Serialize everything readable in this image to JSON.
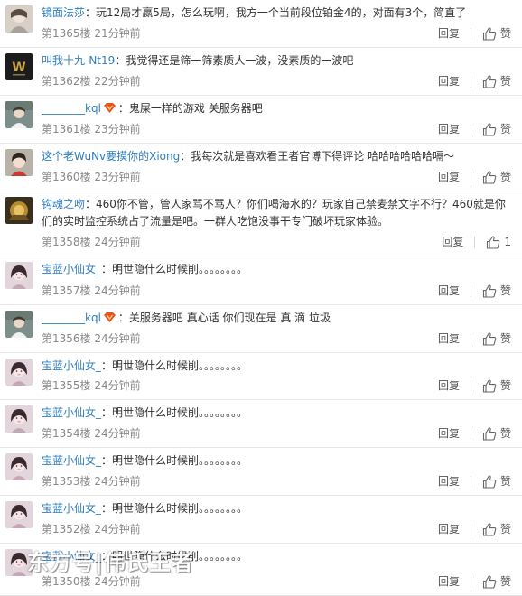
{
  "comments": [
    {
      "username": "镜面法莎",
      "text": "玩12局才赢5局，怎么玩啊，我方一个当前段位铂金4的，对面有3个，简直了",
      "floor": "第1365楼",
      "time": "21分钟前",
      "reply": "回复",
      "like": "赞",
      "avatar": "avatar-mirror"
    },
    {
      "username": "叫我十九-Nt19",
      "text": "我觉得还是筛一筛素质人一波，没素质的一波吧",
      "floor": "第1362楼",
      "time": "22分钟前",
      "reply": "回复",
      "like": "赞",
      "avatar": "avatar-w-logo"
    },
    {
      "username": "________kql",
      "text": "鬼屎一样的游戏 关服务器吧",
      "floor": "第1361楼",
      "time": "23分钟前",
      "reply": "回复",
      "like": "赞",
      "avatar": "avatar-character"
    },
    {
      "username": "这个老WuNv要摸你的Xiong",
      "text": "我每次就是喜欢看王者官博下得评论 哈哈哈哈哈哈嗝～",
      "floor": "第1360楼",
      "time": "23分钟前",
      "reply": "回复",
      "like": "赞",
      "avatar": "avatar-girl"
    },
    {
      "username": "钩魂之吻",
      "text": "460你不管，管人家骂不骂人？你们喝海水的？玩家自己禁麦禁文字不行？460就是你们的实时监控系统占了流量是吧。一群人吃饱没事干专门破坏玩家体验。",
      "floor": "第1358楼",
      "time": "24分钟前",
      "reply": "回复",
      "like": "1",
      "avatar": "avatar-gold"
    },
    {
      "username": "宝蓝小仙女_",
      "text": "明世隐什么时候削。。。。。。。。",
      "floor": "第1357楼",
      "time": "24分钟前",
      "reply": "回复",
      "like": "赞",
      "avatar": "avatar-woman"
    },
    {
      "username": "________kql",
      "text": "关服务器吧 真心话 你们现在是 真 滴 垃圾",
      "floor": "第1356楼",
      "time": "24分钟前",
      "reply": "回复",
      "like": "赞",
      "avatar": "avatar-character"
    },
    {
      "username": "宝蓝小仙女_",
      "text": "明世隐什么时候削。。。。。。。。",
      "floor": "第1355楼",
      "time": "24分钟前",
      "reply": "回复",
      "like": "赞",
      "avatar": "avatar-woman"
    },
    {
      "username": "宝蓝小仙女_",
      "text": "明世隐什么时候削。。。。。。。。",
      "floor": "第1354楼",
      "time": "24分钟前",
      "reply": "回复",
      "like": "赞",
      "avatar": "avatar-woman"
    },
    {
      "username": "宝蓝小仙女_",
      "text": "明世隐什么时候削。。。。。。。。",
      "floor": "第1353楼",
      "time": "24分钟前",
      "reply": "回复",
      "like": "赞",
      "avatar": "avatar-woman"
    },
    {
      "username": "宝蓝小仙女_",
      "text": "明世隐什么时候削。。。。。。。。",
      "floor": "第1352楼",
      "time": "24分钟前",
      "reply": "回复",
      "like": "赞",
      "avatar": "avatar-woman"
    },
    {
      "username": "宝蓝小仙女_",
      "text": "明世隐什么时候削。。。。。。。。",
      "floor": "第1350楼",
      "time": "24分钟前",
      "reply": "回复",
      "like": "赞",
      "avatar": "avatar-woman"
    }
  ],
  "watermark": "东方号|伟氏王者",
  "colors": {
    "username": "#2e7fc2",
    "text": "#333333",
    "meta": "#888888",
    "divider": "#e6e6e6",
    "vip_badge": "#e8541c"
  }
}
